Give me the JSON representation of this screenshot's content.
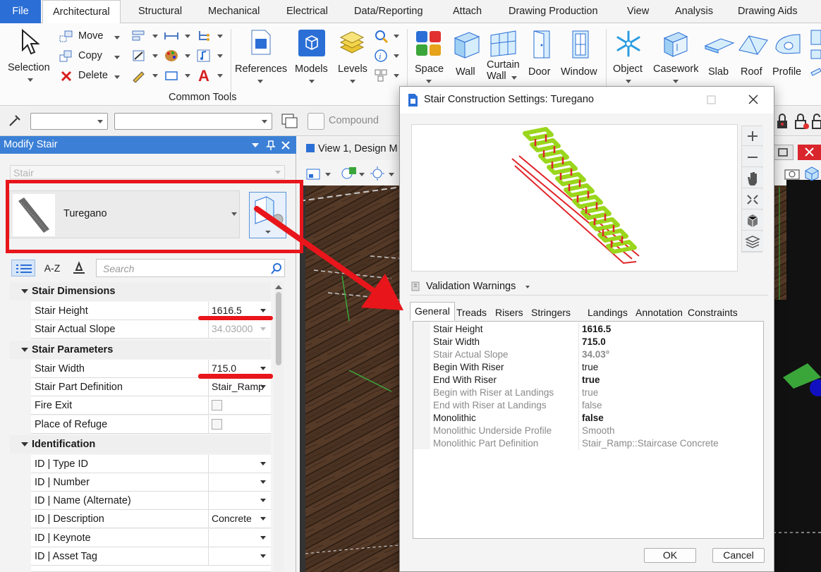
{
  "tabs": [
    "File",
    "Architectural",
    "Structural",
    "Mechanical",
    "Electrical",
    "Data/Reporting",
    "Attach",
    "Drawing Production",
    "View",
    "Analysis",
    "Drawing Aids"
  ],
  "ribbon": {
    "selection": "Selection",
    "move": "Move",
    "copy": "Copy",
    "delete": "Delete",
    "group_common": "Common Tools",
    "references": "References",
    "models": "Models",
    "levels": "Levels",
    "space": "Space",
    "wall": "Wall",
    "curtain_wall_1": "Curtain",
    "curtain_wall_2": "Wall",
    "door": "Door",
    "window": "Window",
    "object": "Object",
    "casework": "Casework",
    "slab": "Slab",
    "roof": "Roof",
    "profile": "Profile"
  },
  "toolbar": {
    "compound": "Compound"
  },
  "panel": {
    "title": "Modify Stair",
    "type_field": "Stair",
    "stair_name": "Turegano",
    "tab_az": "A-Z",
    "search_placeholder": "Search",
    "sections": [
      {
        "title": "Stair Dimensions"
      },
      {
        "title": "Stair Parameters"
      },
      {
        "title": "Identification"
      }
    ],
    "rows": {
      "stair_height": {
        "label": "Stair Height",
        "value": "1616.5"
      },
      "actual_slope": {
        "label": "Stair Actual Slope",
        "value": "34.03000"
      },
      "stair_width": {
        "label": "Stair Width",
        "value": "715.0"
      },
      "part_def": {
        "label": "Stair Part Definition",
        "value": "Stair_Ramp"
      },
      "fire_exit": {
        "label": "Fire Exit"
      },
      "refuge": {
        "label": "Place of Refuge"
      },
      "type_id": {
        "label": "ID | Type ID",
        "value": ""
      },
      "number": {
        "label": "ID | Number",
        "value": ""
      },
      "name_alt": {
        "label": "ID | Name (Alternate)",
        "value": ""
      },
      "description": {
        "label": "ID | Description",
        "value": "Concrete"
      },
      "keynote": {
        "label": "ID | Keynote",
        "value": ""
      },
      "asset_tag": {
        "label": "ID | Asset Tag",
        "value": ""
      }
    }
  },
  "viewport": {
    "title": "View 1, Design M"
  },
  "dialog": {
    "title": "Stair Construction Settings: Turegano",
    "validation": "Validation Warnings",
    "tabs": [
      "General",
      "Treads",
      "Risers",
      "Stringers",
      "Landings",
      "Annotation",
      "Constraints"
    ],
    "properties": [
      {
        "key": "Stair Height",
        "value": "1616.5",
        "state": "bold"
      },
      {
        "key": "Stair Width",
        "value": "715.0",
        "state": "bold"
      },
      {
        "key": "Stair Actual Slope",
        "value": "34.03°",
        "state": "dimbold"
      },
      {
        "key": "Begin With Riser",
        "value": "true",
        "state": "normal"
      },
      {
        "key": "End With Riser",
        "value": "true",
        "state": "bold"
      },
      {
        "key": "Begin with Riser at Landings",
        "value": "true",
        "state": "dim"
      },
      {
        "key": "End with Riser at Landings",
        "value": "false",
        "state": "dim"
      },
      {
        "key": "Monolithic",
        "value": "false",
        "state": "bold"
      },
      {
        "key": "Monolithic Underside Profile",
        "value": "Smooth",
        "state": "dim"
      },
      {
        "key": "Monolithic Part Definition",
        "value": "Stair_Ramp::Staircase Concrete",
        "state": "dim"
      }
    ],
    "ok": "OK",
    "cancel": "Cancel"
  },
  "colors": {
    "accent": "#2b6fd6",
    "panel_title": "#3b80d6",
    "annotation": "#e8151b",
    "stair_green": "#9ad61c",
    "stair_red": "#e0242a"
  }
}
